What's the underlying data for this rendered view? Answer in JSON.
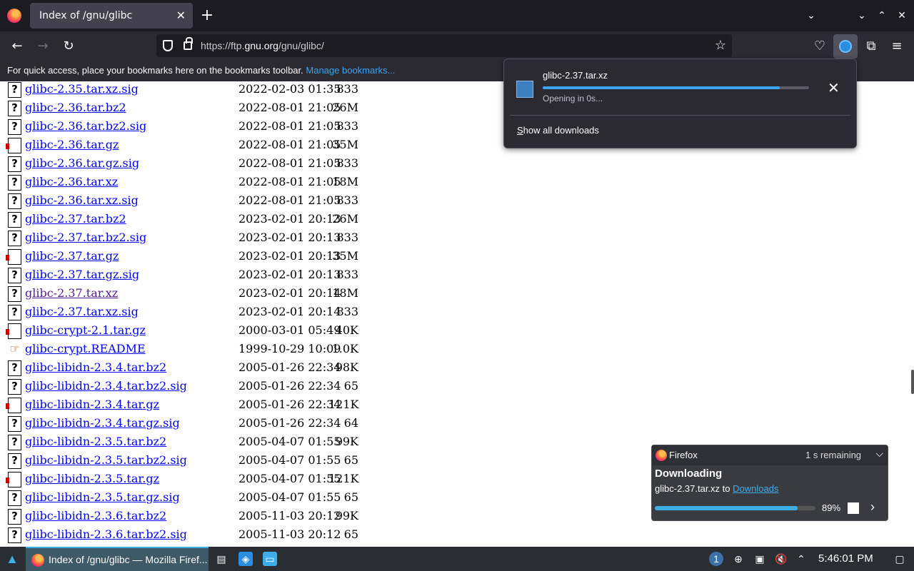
{
  "browser": {
    "tab_title": "Index of /gnu/glibc",
    "tab_close": "✕",
    "new_tab": "+",
    "url_prefix": "https://ftp.",
    "url_host": "gnu.org",
    "url_path": "/gnu/glibc/",
    "bookmarks_hint": "For quick access, place your bookmarks here on the bookmarks toolbar.",
    "manage_bookmarks": "Manage bookmarks..."
  },
  "listing": [
    {
      "name": "glibc-2.35.tar.xz.sig",
      "date": "2022-02-03 01:35",
      "size": "833",
      "icon": "?",
      "type": "unknown"
    },
    {
      "name": "glibc-2.36.tar.bz2",
      "date": "2022-08-01 21:05",
      "size": "26M",
      "icon": "?",
      "type": "unknown"
    },
    {
      "name": "glibc-2.36.tar.bz2.sig",
      "date": "2022-08-01 21:05",
      "size": "833",
      "icon": "?",
      "type": "unknown"
    },
    {
      "name": "glibc-2.36.tar.gz",
      "date": "2022-08-01 21:05",
      "size": "35M",
      "icon": "",
      "type": "gz"
    },
    {
      "name": "glibc-2.36.tar.gz.sig",
      "date": "2022-08-01 21:05",
      "size": "833",
      "icon": "?",
      "type": "unknown"
    },
    {
      "name": "glibc-2.36.tar.xz",
      "date": "2022-08-01 21:05",
      "size": "18M",
      "icon": "?",
      "type": "unknown"
    },
    {
      "name": "glibc-2.36.tar.xz.sig",
      "date": "2022-08-01 21:05",
      "size": "833",
      "icon": "?",
      "type": "unknown"
    },
    {
      "name": "glibc-2.37.tar.bz2",
      "date": "2023-02-01 20:13",
      "size": "26M",
      "icon": "?",
      "type": "unknown"
    },
    {
      "name": "glibc-2.37.tar.bz2.sig",
      "date": "2023-02-01 20:13",
      "size": "833",
      "icon": "?",
      "type": "unknown"
    },
    {
      "name": "glibc-2.37.tar.gz",
      "date": "2023-02-01 20:13",
      "size": "35M",
      "icon": "",
      "type": "gz"
    },
    {
      "name": "glibc-2.37.tar.gz.sig",
      "date": "2023-02-01 20:13",
      "size": "833",
      "icon": "?",
      "type": "unknown"
    },
    {
      "name": "glibc-2.37.tar.xz",
      "date": "2023-02-01 20:14",
      "size": "18M",
      "icon": "?",
      "type": "unknown",
      "visited": true
    },
    {
      "name": "glibc-2.37.tar.xz.sig",
      "date": "2023-02-01 20:14",
      "size": "833",
      "icon": "?",
      "type": "unknown"
    },
    {
      "name": "glibc-crypt-2.1.tar.gz",
      "date": "2000-03-01 05:49",
      "size": "40K",
      "icon": "",
      "type": "gz"
    },
    {
      "name": "glibc-crypt.README",
      "date": "1999-10-29 10:09",
      "size": "1.0K",
      "icon": "☞",
      "type": "readme"
    },
    {
      "name": "glibc-libidn-2.3.4.tar.bz2",
      "date": "2005-01-26 22:34",
      "size": "98K",
      "icon": "?",
      "type": "unknown"
    },
    {
      "name": "glibc-libidn-2.3.4.tar.bz2.sig",
      "date": "2005-01-26 22:34",
      "size": "65",
      "icon": "?",
      "type": "unknown"
    },
    {
      "name": "glibc-libidn-2.3.4.tar.gz",
      "date": "2005-01-26 22:34",
      "size": "121K",
      "icon": "",
      "type": "gz"
    },
    {
      "name": "glibc-libidn-2.3.4.tar.gz.sig",
      "date": "2005-01-26 22:34",
      "size": "64",
      "icon": "?",
      "type": "unknown"
    },
    {
      "name": "glibc-libidn-2.3.5.tar.bz2",
      "date": "2005-04-07 01:55",
      "size": "99K",
      "icon": "?",
      "type": "unknown"
    },
    {
      "name": "glibc-libidn-2.3.5.tar.bz2.sig",
      "date": "2005-04-07 01:55",
      "size": "65",
      "icon": "?",
      "type": "unknown"
    },
    {
      "name": "glibc-libidn-2.3.5.tar.gz",
      "date": "2005-04-07 01:55",
      "size": "121K",
      "icon": "",
      "type": "gz"
    },
    {
      "name": "glibc-libidn-2.3.5.tar.gz.sig",
      "date": "2005-04-07 01:55",
      "size": "65",
      "icon": "?",
      "type": "unknown"
    },
    {
      "name": "glibc-libidn-2.3.6.tar.bz2",
      "date": "2005-11-03 20:12",
      "size": "99K",
      "icon": "?",
      "type": "unknown"
    },
    {
      "name": "glibc-libidn-2.3.6.tar.bz2.sig",
      "date": "2005-11-03 20:12",
      "size": "65",
      "icon": "?",
      "type": "unknown"
    }
  ],
  "downloads_panel": {
    "file_name": "glibc-2.37.tar.xz",
    "progress": 0.89,
    "status": "Opening in 0s...",
    "show_all_prefix": "S",
    "show_all_rest": "how all downloads"
  },
  "notification": {
    "app": "Firefox",
    "time_remaining": "1 s remaining",
    "title": "Downloading",
    "body_prefix": "glibc-2.37.tar.xz to ",
    "link": "Downloads",
    "progress": 0.89,
    "percent_label": "89%"
  },
  "taskbar": {
    "window_title": "Index of /gnu/glibc — Mozilla Firef...",
    "clock": "5:46:01 PM",
    "badge": "1"
  },
  "colors": {
    "accent": "#3daee9",
    "link": "#0000ee",
    "visited": "#551a8b"
  }
}
